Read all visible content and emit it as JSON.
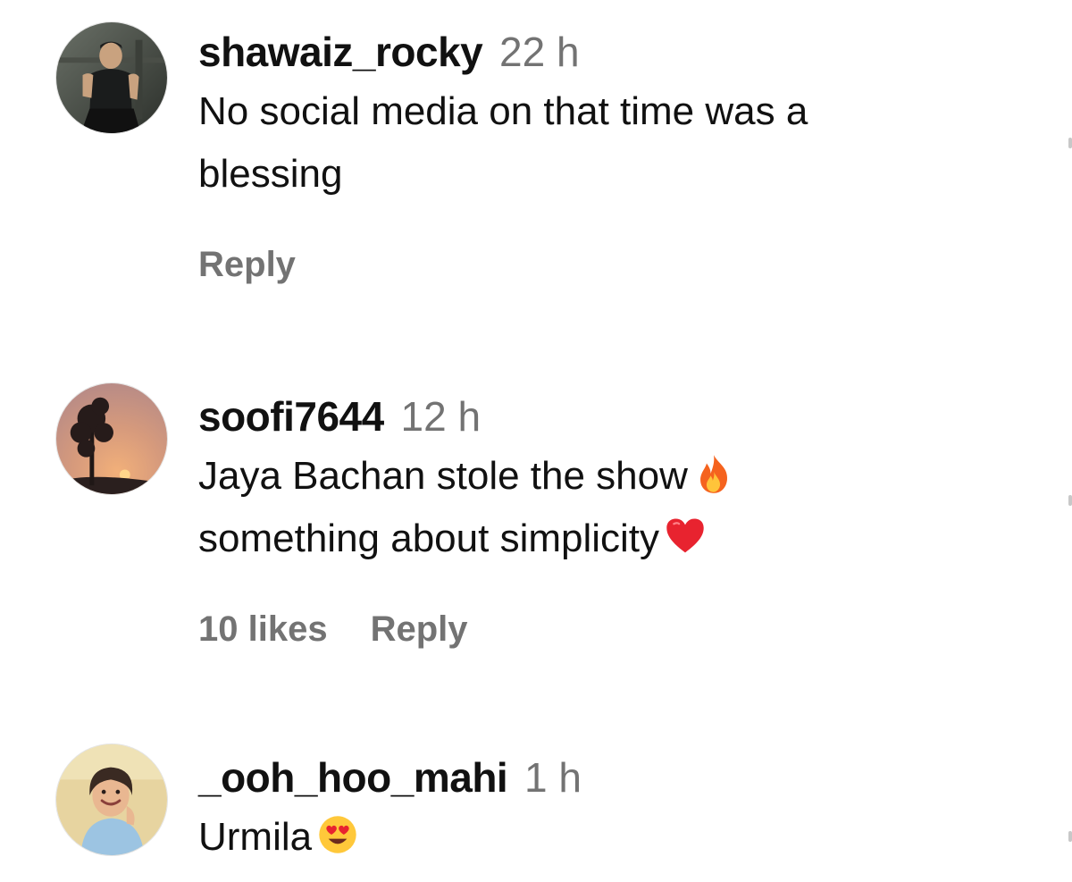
{
  "comments": [
    {
      "username": "shawaiz_rocky",
      "time": "22 h",
      "line1": "No social media on that time was a",
      "line2": "blessing",
      "emoji1": "",
      "emoji2": "",
      "likes": "",
      "reply": "Reply",
      "avatar_icon": "gym-man-avatar"
    },
    {
      "username": "soofi7644",
      "time": "12 h",
      "line1": "Jaya Bachan stole the show",
      "line2": "something about simplicity",
      "emoji1": "fire-emoji",
      "emoji2": "red-heart-emoji",
      "likes": "10 likes",
      "reply": "Reply",
      "avatar_icon": "sunset-tree-avatar"
    },
    {
      "username": "_ooh_hoo_mahi",
      "time": "1 h",
      "line1": "Urmila",
      "line2": "",
      "emoji1": "heart-eyes-emoji",
      "emoji2": "",
      "likes": "",
      "reply": "",
      "avatar_icon": "smiling-woman-avatar"
    }
  ],
  "colors": {
    "text": "#111111",
    "muted": "#737373"
  }
}
